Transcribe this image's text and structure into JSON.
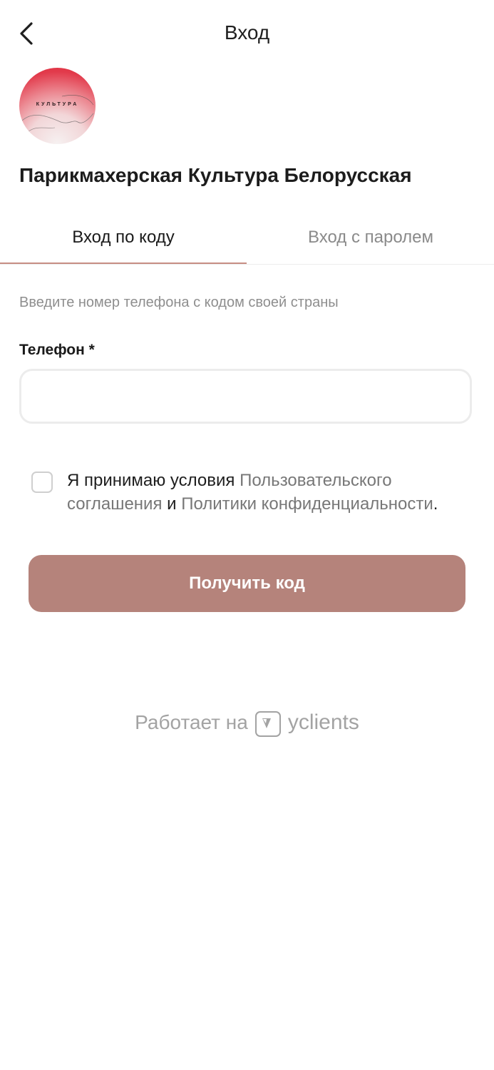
{
  "header": {
    "title": "Вход",
    "back_icon": "chevron-left-icon"
  },
  "logo": {
    "text": "КУЛЬТУРА"
  },
  "company": {
    "name": "Парикмахерская Культура Белорусская"
  },
  "tabs": [
    {
      "label": "Вход по коду",
      "active": true
    },
    {
      "label": "Вход с паролем",
      "active": false
    }
  ],
  "form": {
    "hint": "Введите номер телефона с кодом своей страны",
    "phone_label": "Телефон *",
    "phone_value": "",
    "phone_placeholder": ""
  },
  "consent": {
    "checked": false,
    "prefix": "Я принимаю условия ",
    "agreement_link": "Пользовательского соглашения",
    "middle": " и ",
    "policy_link": "Политики конфиденциальности",
    "suffix": "."
  },
  "submit": {
    "label": "Получить код"
  },
  "footer": {
    "powered_by": "Работает на",
    "brand": "yclients",
    "brand_icon": "yclients-logo-icon"
  },
  "colors": {
    "accent": "#b5837b",
    "tab_indicator": "#c78e84",
    "muted_text": "#8e8e8e",
    "logo_red": "#e0303f"
  }
}
